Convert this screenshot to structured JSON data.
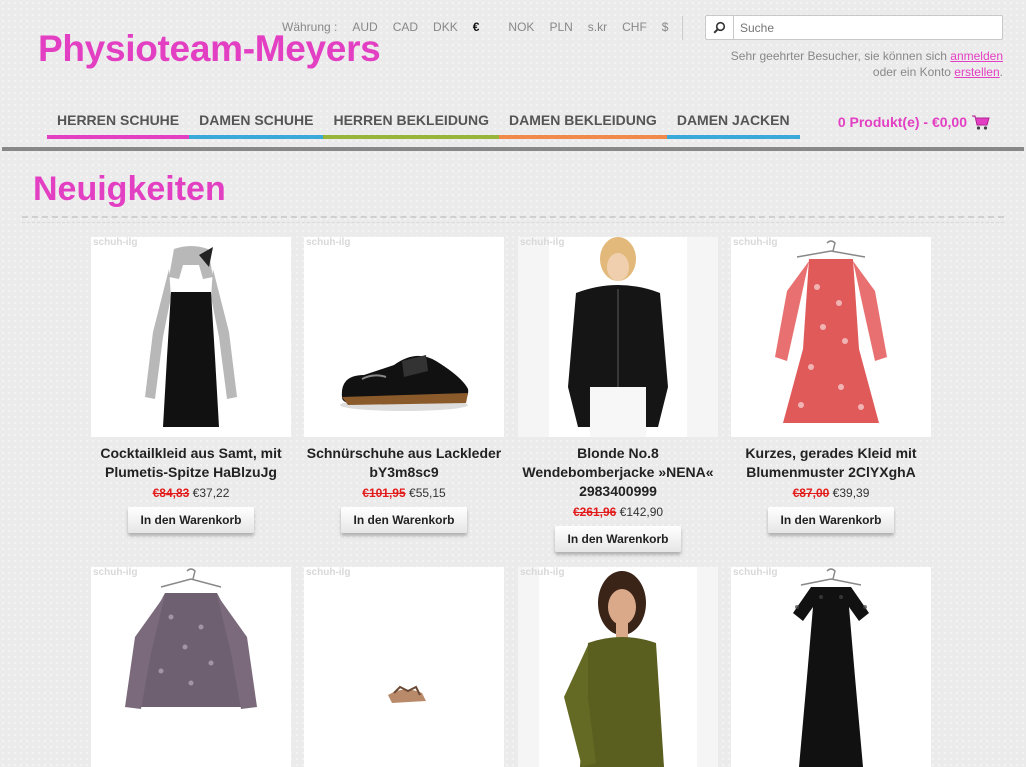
{
  "site": {
    "logo": "Physioteam-Meyers"
  },
  "currency": {
    "label": "Währung :",
    "options": [
      "AUD",
      "CAD",
      "DKK",
      "€",
      "NOK",
      "PLN",
      "s.kr",
      "CHF",
      "$"
    ],
    "active": "€"
  },
  "search": {
    "placeholder": "Suche"
  },
  "welcome": {
    "line1": "Sehr geehrter Besucher, sie können sich",
    "login_link": "anmelden",
    "line2": "oder ein Konto",
    "register_link": "erstellen",
    "period": "."
  },
  "nav": [
    {
      "label": "HERREN SCHUHE",
      "color": "#e33fc3"
    },
    {
      "label": "DAMEN SCHUHE",
      "color": "#3aa8d8"
    },
    {
      "label": "HERREN BEKLEIDUNG",
      "color": "#96b53a"
    },
    {
      "label": "DAMEN BEKLEIDUNG",
      "color": "#f08a4b"
    },
    {
      "label": "DAMEN JACKEN",
      "color": "#3aa8d8"
    }
  ],
  "cart": {
    "label": "0 Produkt(e) - €0,00"
  },
  "section": {
    "title": "Neuigkeiten"
  },
  "watermark": "schuh-ilg",
  "button_label": "In den Warenkorb",
  "products": [
    {
      "name": "Cocktailkleid aus Samt, mit Plumetis-Spitze HaBlzuJg",
      "old_price": "€84,83",
      "new_price": "€37,22",
      "image": "black-dress"
    },
    {
      "name": "Schnürschuhe aus Lackleder bY3m8sc9",
      "old_price": "€101,95",
      "new_price": "€55,15",
      "image": "patent-shoe"
    },
    {
      "name": "Blonde No.8 Wendebomberjacke »NENA« 2983400999",
      "old_price": "€261,96",
      "new_price": "€142,90",
      "image": "bomber-jacket"
    },
    {
      "name": "Kurzes, gerades Kleid mit Blumenmuster 2ClYXghA",
      "old_price": "€87,00",
      "new_price": "€39,39",
      "image": "floral-dress"
    },
    {
      "name": "",
      "old_price": "",
      "new_price": "",
      "image": "floral-blouse"
    },
    {
      "name": "",
      "old_price": "",
      "new_price": "",
      "image": "sandal"
    },
    {
      "name": "",
      "old_price": "",
      "new_price": "",
      "image": "olive-top"
    },
    {
      "name": "",
      "old_price": "",
      "new_price": "",
      "image": "black-lace-dress"
    }
  ]
}
